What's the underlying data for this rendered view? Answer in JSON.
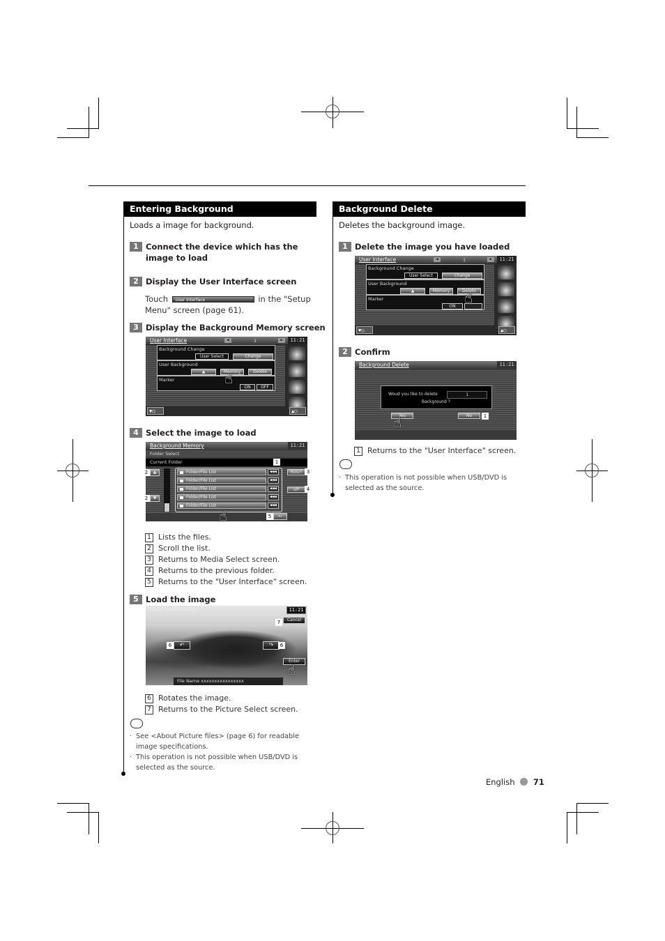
{
  "page": {
    "footer_language": "English",
    "page_number": "71"
  },
  "left": {
    "heading": "Entering Background",
    "intro": "Loads a image for background.",
    "steps": [
      {
        "num": "1",
        "text": "Connect the device which has the image to load"
      },
      {
        "num": "2",
        "text": "Display the User Interface screen"
      },
      {
        "num": "3",
        "text": "Display the Background Memory screen"
      },
      {
        "num": "4",
        "text": "Select the image to load"
      },
      {
        "num": "5",
        "text": "Load the image"
      }
    ],
    "step2_body": {
      "before": "Touch",
      "button_label": "User Interface",
      "after": "in the \"Setup Menu\" screen (page 61)."
    },
    "step4_callouts": [
      {
        "num": "1",
        "text": "Lists the files."
      },
      {
        "num": "2",
        "text": "Scroll the list."
      },
      {
        "num": "3",
        "text": "Returns to Media Select screen."
      },
      {
        "num": "4",
        "text": "Returns to the previous folder."
      },
      {
        "num": "5",
        "text": "Returns to the \"User Interface\" screen."
      }
    ],
    "step5_callouts": [
      {
        "num": "6",
        "text": "Rotates the image."
      },
      {
        "num": "7",
        "text": "Returns to the Picture Select screen."
      }
    ],
    "notes": [
      "See <About Picture files> (page 6) for readable image specifications.",
      "This operation is not possible when USB/DVD is selected as the source."
    ]
  },
  "right": {
    "heading": "Background Delete",
    "intro": "Deletes the background image.",
    "steps": [
      {
        "num": "1",
        "text": "Delete the image you have loaded"
      },
      {
        "num": "2",
        "text": "Confirm"
      }
    ],
    "callouts": [
      {
        "num": "1",
        "text": "Returns to the \"User Interface\" screen."
      }
    ],
    "notes": [
      "This operation is not possible when USB/DVD is selected as the source."
    ]
  },
  "screens": {
    "clock": "11:21",
    "user_interface": {
      "title": "User Interface",
      "page": "1",
      "background_change": "Background Change",
      "user_select": "User Select",
      "change": "Change",
      "user_background": "User Background",
      "eject": "▲",
      "memory": "Memory",
      "delete": "Delete",
      "marker": "Marker",
      "on": "ON",
      "off": "OFF"
    },
    "background_memory": {
      "title": "Background Memory",
      "folder_select": "Folder Select",
      "current_folder": "Current Folder",
      "rows": [
        "Folder/File List",
        "Folder/File List",
        "Folder/File List",
        "Folder/File List",
        "Folder/File List"
      ],
      "row_arrow": "◀◀◀",
      "root": "ROOT",
      "up": "UP"
    },
    "load_image": {
      "title": "Background Memory",
      "cancel": "Cancel",
      "enter": "Enter",
      "file_name": "File Name xxxxxxxxxxxxxxxx"
    },
    "background_delete": {
      "title": "Background Delete",
      "question": "Woud you like to delete",
      "value": "1",
      "subject": "Background ?",
      "yes": "Yes",
      "no": "No"
    }
  }
}
